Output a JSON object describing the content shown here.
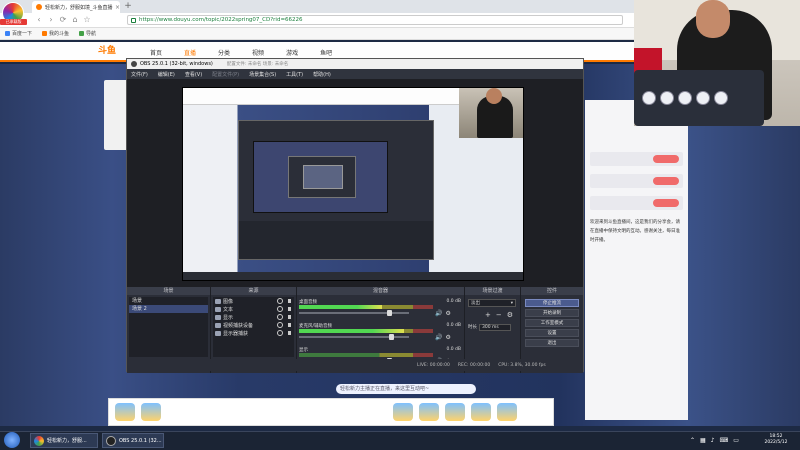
{
  "browser": {
    "logo_badge": "已承载版",
    "tab_title": "轻松新力，舒服如境_斗鱼直播",
    "new_tab": "+",
    "nav": {
      "back": "‹",
      "forward": "›",
      "reload": "⟳",
      "home": "⌂",
      "star": "☆"
    },
    "url": "https://www.douyu.com/topic/2022spring07_CD?rid=66226",
    "bookmarks": [
      "百度一下",
      "我的斗鱼",
      "导航"
    ]
  },
  "site": {
    "logo": "斗鱼",
    "nav_items": [
      "首页",
      "直播",
      "分类",
      "视频",
      "游戏",
      "鱼吧"
    ],
    "right_panel_text": "欢迎来到斗鱼直播间，这是我们的分享会，请在直播中保持文明的互动。感谢关注，每日准时开播。",
    "chat_placeholder": "轻松新力主播正在直播，来这里互动吧~"
  },
  "obs": {
    "title": "OBS 25.0.1 (32-bit, windows)",
    "title_extra": "配置文件: 未命名   场景: 未命名",
    "menus": [
      "文件(F)",
      "编辑(E)",
      "查看(V)",
      "配置文件(P)",
      "场景集合(S)",
      "工具(T)",
      "帮助(H)"
    ],
    "docks": {
      "scenes": {
        "header": "场景",
        "items": [
          "场景",
          "场景 2"
        ]
      },
      "sources": {
        "header": "来源",
        "items": [
          "图像",
          "文本",
          "显示",
          "视频捕获设备",
          "显示器捕获"
        ]
      },
      "mixer": {
        "header": "混音器",
        "tracks": [
          {
            "label": "桌面音频",
            "db": "0.0 dB",
            "level": 0.62,
            "volume": 0.82
          },
          {
            "label": "麦克风/辅助音频",
            "db": "0.0 dB",
            "level": 0.78,
            "volume": 0.84
          },
          {
            "label": "显示",
            "db": "0.0 dB",
            "level": 0.0,
            "volume": 0.82
          }
        ]
      },
      "transitions": {
        "header": "场景过渡",
        "selected": "淡出",
        "duration_label": "时长",
        "duration_value": "300 ms"
      },
      "controls": {
        "header": "控件",
        "buttons": [
          "停止推流",
          "开始录制",
          "工作室模式",
          "设置",
          "退出"
        ]
      }
    },
    "status": {
      "live": "LIVE: 00:00:00",
      "rec": "REC: 00:00:00",
      "cpu": "CPU: 3.8%, 30.00 fps"
    }
  },
  "taskbar": {
    "items": [
      "轻松新力，舒服...",
      "OBS 25.0.1 (32..."
    ],
    "time": "18:52",
    "date": "2022/5/12"
  },
  "colors": {
    "accent_orange": "#ff7a00",
    "obs_bg": "#2b2e38",
    "taskbar": "#1b2434"
  }
}
